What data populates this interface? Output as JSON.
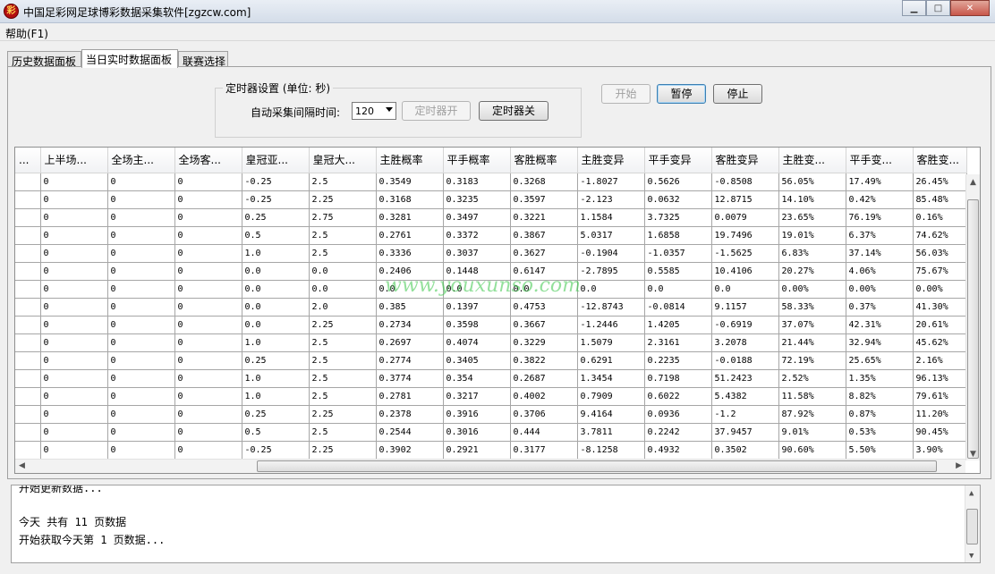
{
  "window": {
    "title": "中国足彩网足球博彩数据采集软件[zgzcw.com]",
    "icon": "app-logo-icon",
    "controls": [
      "minimize-icon",
      "maximize-icon",
      "close-icon"
    ]
  },
  "menu": {
    "help_label": "帮助(F1)"
  },
  "tabs": [
    {
      "label": "历史数据面板"
    },
    {
      "label": "当日实时数据面板",
      "active": true
    },
    {
      "label": "联赛选择"
    }
  ],
  "timer": {
    "legend": "定时器设置 (单位: 秒)",
    "interval_label": "自动采集间隔时间:",
    "interval_value": "120",
    "on_label": "定时器开",
    "off_label": "定时器关"
  },
  "controls": {
    "start_label": "开始",
    "pause_label": "暂停",
    "stop_label": "停止"
  },
  "table": {
    "columns": [
      "...",
      "上半场...",
      "全场主...",
      "全场客...",
      "皇冠亚...",
      "皇冠大...",
      "主胜概率",
      "平手概率",
      "客胜概率",
      "主胜变异",
      "平手变异",
      "客胜变异",
      "主胜变...",
      "平手变...",
      "客胜变..."
    ],
    "rows": [
      [
        "",
        "0",
        "0",
        "0",
        "-0.25",
        "2.5",
        "0.3549",
        "0.3183",
        "0.3268",
        "-1.8027",
        "0.5626",
        "-0.8508",
        "56.05%",
        "17.49%",
        "26.45%"
      ],
      [
        "",
        "0",
        "0",
        "0",
        "-0.25",
        "2.25",
        "0.3168",
        "0.3235",
        "0.3597",
        "-2.123",
        "0.0632",
        "12.8715",
        "14.10%",
        "0.42%",
        "85.48%"
      ],
      [
        "",
        "0",
        "0",
        "0",
        "0.25",
        "2.75",
        "0.3281",
        "0.3497",
        "0.3221",
        "1.1584",
        "3.7325",
        "0.0079",
        "23.65%",
        "76.19%",
        "0.16%"
      ],
      [
        "",
        "0",
        "0",
        "0",
        "0.5",
        "2.5",
        "0.2761",
        "0.3372",
        "0.3867",
        "5.0317",
        "1.6858",
        "19.7496",
        "19.01%",
        "6.37%",
        "74.62%"
      ],
      [
        "",
        "0",
        "0",
        "0",
        "1.0",
        "2.5",
        "0.3336",
        "0.3037",
        "0.3627",
        "-0.1904",
        "-1.0357",
        "-1.5625",
        "6.83%",
        "37.14%",
        "56.03%"
      ],
      [
        "",
        "0",
        "0",
        "0",
        "0.0",
        "0.0",
        "0.2406",
        "0.1448",
        "0.6147",
        "-2.7895",
        "0.5585",
        "10.4106",
        "20.27%",
        "4.06%",
        "75.67%"
      ],
      [
        "",
        "0",
        "0",
        "0",
        "0.0",
        "0.0",
        "0.0",
        "0.0",
        "0.0",
        "0.0",
        "0.0",
        "0.0",
        "0.00%",
        "0.00%",
        "0.00%"
      ],
      [
        "",
        "0",
        "0",
        "0",
        "0.0",
        "2.0",
        "0.385",
        "0.1397",
        "0.4753",
        "-12.8743",
        "-0.0814",
        "9.1157",
        "58.33%",
        "0.37%",
        "41.30%"
      ],
      [
        "",
        "0",
        "0",
        "0",
        "0.0",
        "2.25",
        "0.2734",
        "0.3598",
        "0.3667",
        "-1.2446",
        "1.4205",
        "-0.6919",
        "37.07%",
        "42.31%",
        "20.61%"
      ],
      [
        "",
        "0",
        "0",
        "0",
        "1.0",
        "2.5",
        "0.2697",
        "0.4074",
        "0.3229",
        "1.5079",
        "2.3161",
        "3.2078",
        "21.44%",
        "32.94%",
        "45.62%"
      ],
      [
        "",
        "0",
        "0",
        "0",
        "0.25",
        "2.5",
        "0.2774",
        "0.3405",
        "0.3822",
        "0.6291",
        "0.2235",
        "-0.0188",
        "72.19%",
        "25.65%",
        "2.16%"
      ],
      [
        "",
        "0",
        "0",
        "0",
        "1.0",
        "2.5",
        "0.3774",
        "0.354",
        "0.2687",
        "1.3454",
        "0.7198",
        "51.2423",
        "2.52%",
        "1.35%",
        "96.13%"
      ],
      [
        "",
        "0",
        "0",
        "0",
        "1.0",
        "2.5",
        "0.2781",
        "0.3217",
        "0.4002",
        "0.7909",
        "0.6022",
        "5.4382",
        "11.58%",
        "8.82%",
        "79.61%"
      ],
      [
        "",
        "0",
        "0",
        "0",
        "0.25",
        "2.25",
        "0.2378",
        "0.3916",
        "0.3706",
        "9.4164",
        "0.0936",
        "-1.2",
        "87.92%",
        "0.87%",
        "11.20%"
      ],
      [
        "",
        "0",
        "0",
        "0",
        "0.5",
        "2.5",
        "0.2544",
        "0.3016",
        "0.444",
        "3.7811",
        "0.2242",
        "37.9457",
        "9.01%",
        "0.53%",
        "90.45%"
      ],
      [
        "",
        "0",
        "0",
        "0",
        "-0.25",
        "2.25",
        "0.3902",
        "0.2921",
        "0.3177",
        "-8.1258",
        "0.4932",
        "0.3502",
        "90.60%",
        "5.50%",
        "3.90%"
      ]
    ]
  },
  "watermark": "www.youxunso.com",
  "log": {
    "lines": [
      "开始更新数据...",
      "",
      "今天 共有 11 页数据",
      "开始获取今天第 1 页数据..."
    ]
  }
}
